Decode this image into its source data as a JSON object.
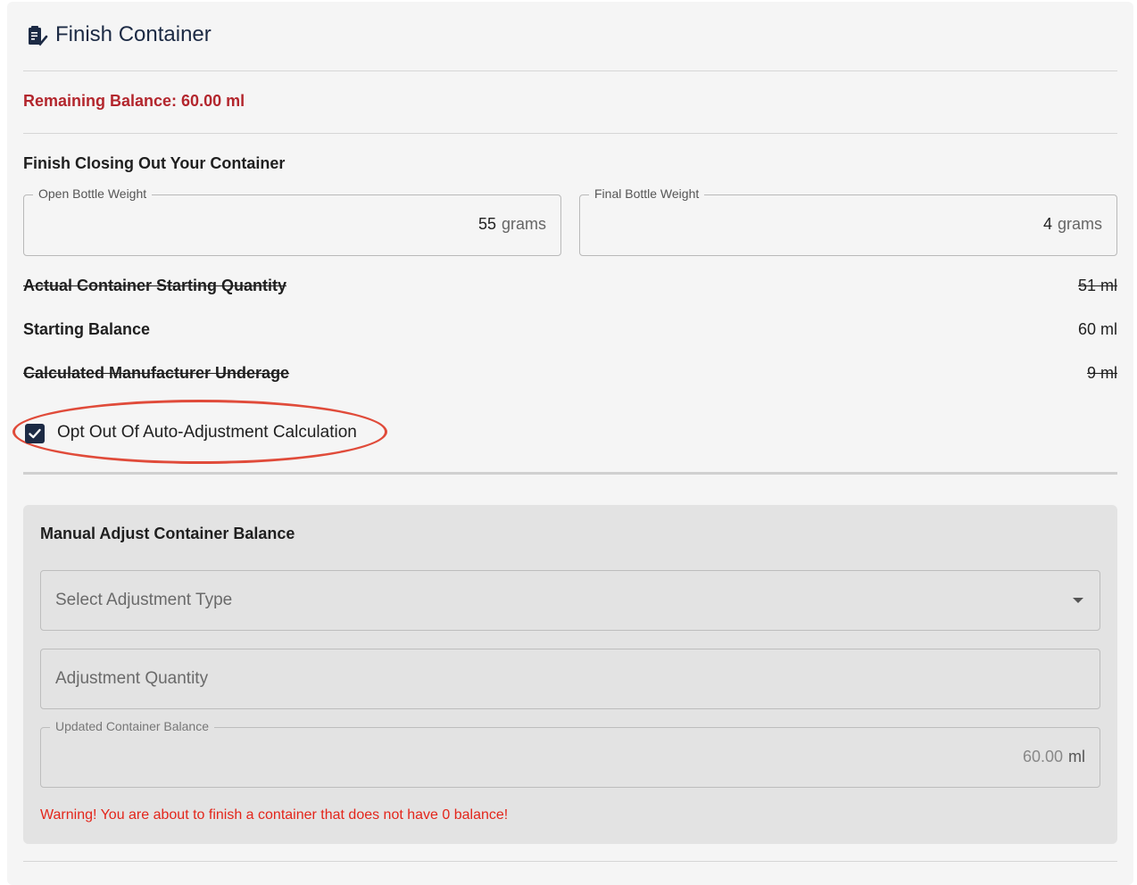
{
  "header": {
    "title": "Finish Container",
    "icon": "clipboard-check-icon"
  },
  "remaining_balance": "Remaining Balance: 60.00 ml",
  "closing_section": {
    "title": "Finish Closing Out Your Container",
    "open_bottle_weight": {
      "label": "Open Bottle Weight",
      "value": "55",
      "unit": "grams"
    },
    "final_bottle_weight": {
      "label": "Final Bottle Weight",
      "value": "4",
      "unit": "grams"
    }
  },
  "summary_rows": [
    {
      "label": "Actual Container Starting Quantity",
      "value": "51 ml",
      "struck": true
    },
    {
      "label": "Starting Balance",
      "value": "60 ml",
      "struck": false
    },
    {
      "label": "Calculated Manufacturer Underage",
      "value": "9 ml",
      "struck": true
    }
  ],
  "opt_out": {
    "label": "Opt Out Of Auto-Adjustment Calculation",
    "checked": true
  },
  "manual_adjust": {
    "title": "Manual Adjust Container Balance",
    "adjustment_type_placeholder": "Select Adjustment Type",
    "adjustment_quantity_placeholder": "Adjustment Quantity",
    "updated_balance": {
      "label": "Updated Container Balance",
      "value": "60.00",
      "unit": "ml"
    },
    "warning": "Warning! You are about to finish a container that does not have 0 balance!"
  },
  "colors": {
    "navy": "#1c2a44",
    "danger": "#b3262d",
    "warning": "#e3261b",
    "highlight_ellipse": "#e04b3a"
  }
}
